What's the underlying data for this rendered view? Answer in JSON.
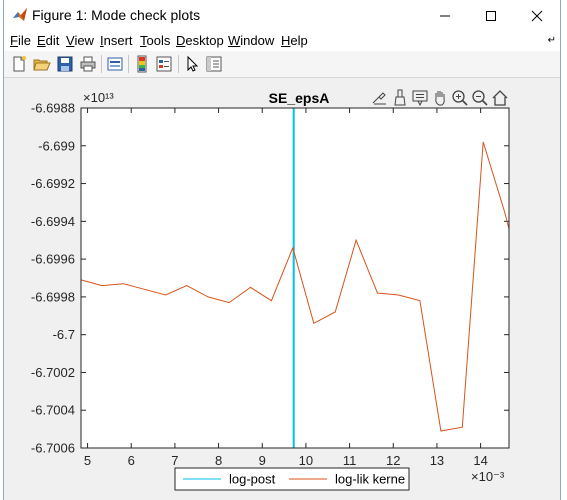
{
  "window": {
    "title": "Figure 1: Mode check plots",
    "controls": [
      "minimize-button",
      "maximize-button",
      "close-button"
    ]
  },
  "menu": [
    {
      "label": "File",
      "mnemonic": "F",
      "rest": "ile"
    },
    {
      "label": "Edit",
      "mnemonic": "E",
      "rest": "dit"
    },
    {
      "label": "View",
      "mnemonic": "V",
      "rest": "iew"
    },
    {
      "label": "Insert",
      "mnemonic": "I",
      "rest": "nsert"
    },
    {
      "label": "Tools",
      "mnemonic": "T",
      "rest": "ools"
    },
    {
      "label": "Desktop",
      "mnemonic": "D",
      "rest": "esktop"
    },
    {
      "label": "Window",
      "mnemonic": "W",
      "rest": "indow"
    },
    {
      "label": "Help",
      "mnemonic": "H",
      "rest": "elp"
    }
  ],
  "toolbar_icons": [
    "new-figure-icon",
    "open-file-icon",
    "save-icon",
    "print-icon",
    "link-plot-icon",
    "colorbar-icon",
    "legend-icon",
    "edit-plot-arrow-icon",
    "property-inspector-icon"
  ],
  "axes_toolbar_icons": [
    "export-icon",
    "brush-icon",
    "data-tips-icon",
    "pan-hand-icon",
    "zoom-in-icon",
    "zoom-out-icon",
    "home-icon"
  ],
  "chart_data": {
    "type": "line",
    "title": "SE_epsA",
    "xlabel": "",
    "ylabel": "",
    "x_exponent_label": "×10⁻³",
    "y_exponent_label": "×10¹³",
    "xlim": [
      4.85,
      14.65
    ],
    "ylim": [
      -6.7006,
      -6.6988
    ],
    "xticks": [
      5,
      6,
      7,
      8,
      9,
      10,
      11,
      12,
      13,
      14
    ],
    "xtick_labels": [
      "5",
      "6",
      "7",
      "8",
      "9",
      "10",
      "11",
      "12",
      "13",
      "14"
    ],
    "yticks": [
      -6.7006,
      -6.7004,
      -6.7002,
      -6.7,
      -6.6998,
      -6.6996,
      -6.6994,
      -6.6992,
      -6.699,
      -6.6988
    ],
    "ytick_labels": [
      "-6.7006",
      "-6.7004",
      "-6.7002",
      "-6.7",
      "-6.6998",
      "-6.6996",
      "-6.6994",
      "-6.6992",
      "-6.699",
      "-6.6988"
    ],
    "grid": false,
    "legend_position": "bottom-center",
    "series": [
      {
        "name": "log-post",
        "color": "#00bfe8",
        "style": "vertical-line",
        "x": [
          9.72,
          9.72
        ],
        "y": [
          -6.7006,
          -6.6988
        ]
      },
      {
        "name": "log-lik kernel",
        "legend_text": "log-lik kerne",
        "color": "#d95319",
        "x": [
          4.85,
          5.33,
          5.82,
          6.3,
          6.79,
          7.27,
          7.76,
          8.24,
          8.73,
          9.21,
          9.7,
          10.18,
          10.67,
          11.15,
          11.64,
          12.12,
          12.61,
          13.09,
          13.58,
          14.06,
          14.55,
          14.65
        ],
        "y": [
          -6.69971,
          -6.69974,
          -6.69973,
          -6.69976,
          -6.69979,
          -6.69974,
          -6.6998,
          -6.69983,
          -6.69975,
          -6.69982,
          -6.69954,
          -6.69994,
          -6.69988,
          -6.6995,
          -6.69978,
          -6.69979,
          -6.69982,
          -6.70051,
          -6.70049,
          -6.69898,
          -6.69935,
          -6.69944
        ]
      }
    ]
  }
}
